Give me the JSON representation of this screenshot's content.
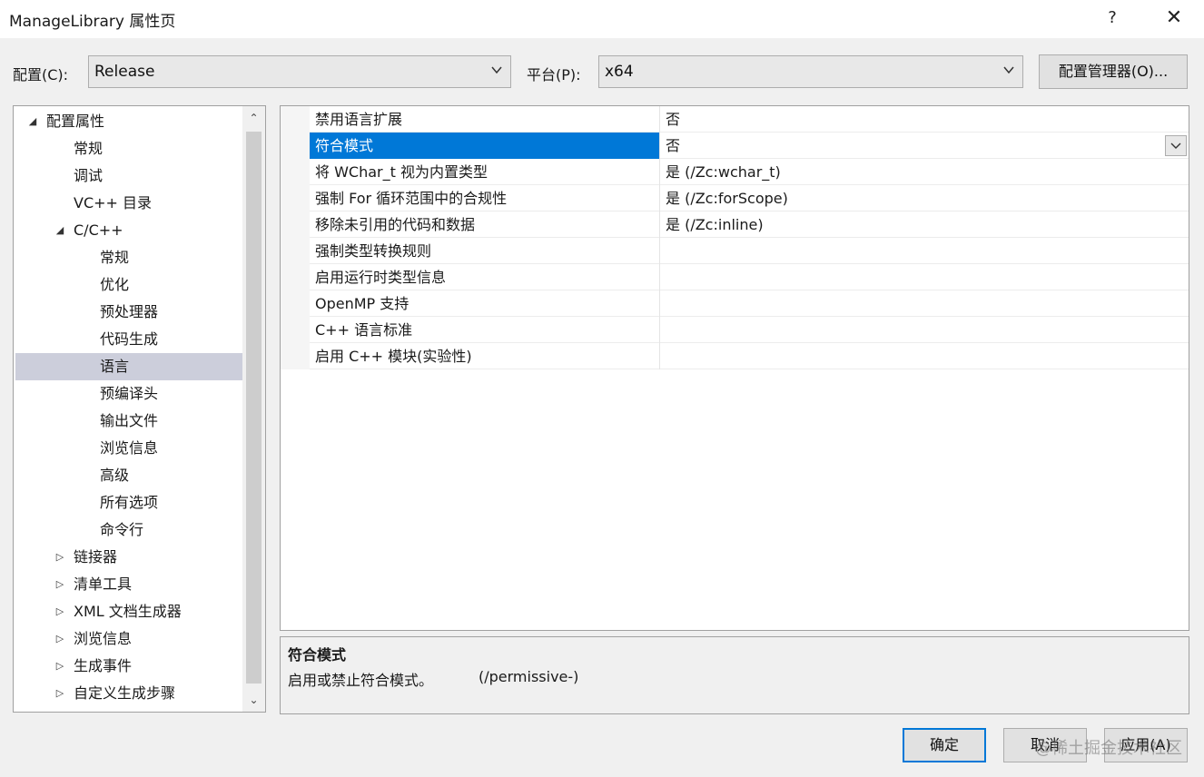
{
  "window": {
    "title": "ManageLibrary 属性页",
    "help_label": "?",
    "close_label": "✕"
  },
  "toolbar": {
    "config_label": "配置(C):",
    "config_value": "Release",
    "platform_label": "平台(P):",
    "platform_value": "x64",
    "config_manager_label": "配置管理器(O)..."
  },
  "tree": {
    "items": [
      {
        "label": "配置属性",
        "toggle": "◢",
        "level": 0
      },
      {
        "label": "常规",
        "toggle": "",
        "level": 1
      },
      {
        "label": "调试",
        "toggle": "",
        "level": 1
      },
      {
        "label": "VC++ 目录",
        "toggle": "",
        "level": 1
      },
      {
        "label": "C/C++",
        "toggle": "◢",
        "level": 1
      },
      {
        "label": "常规",
        "toggle": "",
        "level": 2
      },
      {
        "label": "优化",
        "toggle": "",
        "level": 2
      },
      {
        "label": "预处理器",
        "toggle": "",
        "level": 2
      },
      {
        "label": "代码生成",
        "toggle": "",
        "level": 2
      },
      {
        "label": "语言",
        "toggle": "",
        "level": 2,
        "selected": true
      },
      {
        "label": "预编译头",
        "toggle": "",
        "level": 2
      },
      {
        "label": "输出文件",
        "toggle": "",
        "level": 2
      },
      {
        "label": "浏览信息",
        "toggle": "",
        "level": 2
      },
      {
        "label": "高级",
        "toggle": "",
        "level": 2
      },
      {
        "label": "所有选项",
        "toggle": "",
        "level": 2
      },
      {
        "label": "命令行",
        "toggle": "",
        "level": 2
      },
      {
        "label": "链接器",
        "toggle": "▷",
        "level": 1
      },
      {
        "label": "清单工具",
        "toggle": "▷",
        "level": 1
      },
      {
        "label": "XML 文档生成器",
        "toggle": "▷",
        "level": 1
      },
      {
        "label": "浏览信息",
        "toggle": "▷",
        "level": 1
      },
      {
        "label": "生成事件",
        "toggle": "▷",
        "level": 1
      },
      {
        "label": "自定义生成步骤",
        "toggle": "▷",
        "level": 1
      }
    ],
    "scroll_up": "⌃",
    "scroll_down": "⌄"
  },
  "properties": {
    "rows": [
      {
        "name": "禁用语言扩展",
        "value": "否"
      },
      {
        "name": "符合模式",
        "value": "否",
        "selected": true
      },
      {
        "name": "将 WChar_t 视为内置类型",
        "value": "是 (/Zc:wchar_t)"
      },
      {
        "name": "强制 For 循环范围中的合规性",
        "value": "是 (/Zc:forScope)"
      },
      {
        "name": "移除未引用的代码和数据",
        "value": "是 (/Zc:inline)"
      },
      {
        "name": "强制类型转换规则",
        "value": ""
      },
      {
        "name": "启用运行时类型信息",
        "value": ""
      },
      {
        "name": "OpenMP 支持",
        "value": ""
      },
      {
        "name": "C++ 语言标准",
        "value": ""
      },
      {
        "name": "启用 C++ 模块(实验性)",
        "value": ""
      }
    ]
  },
  "description": {
    "title": "符合模式",
    "text": "启用或禁止符合模式。",
    "switch": "(/permissive-)"
  },
  "buttons": {
    "ok": "确定",
    "cancel": "取消",
    "apply": "应用(A)"
  },
  "watermark": "@稀土掘金技术社区"
}
